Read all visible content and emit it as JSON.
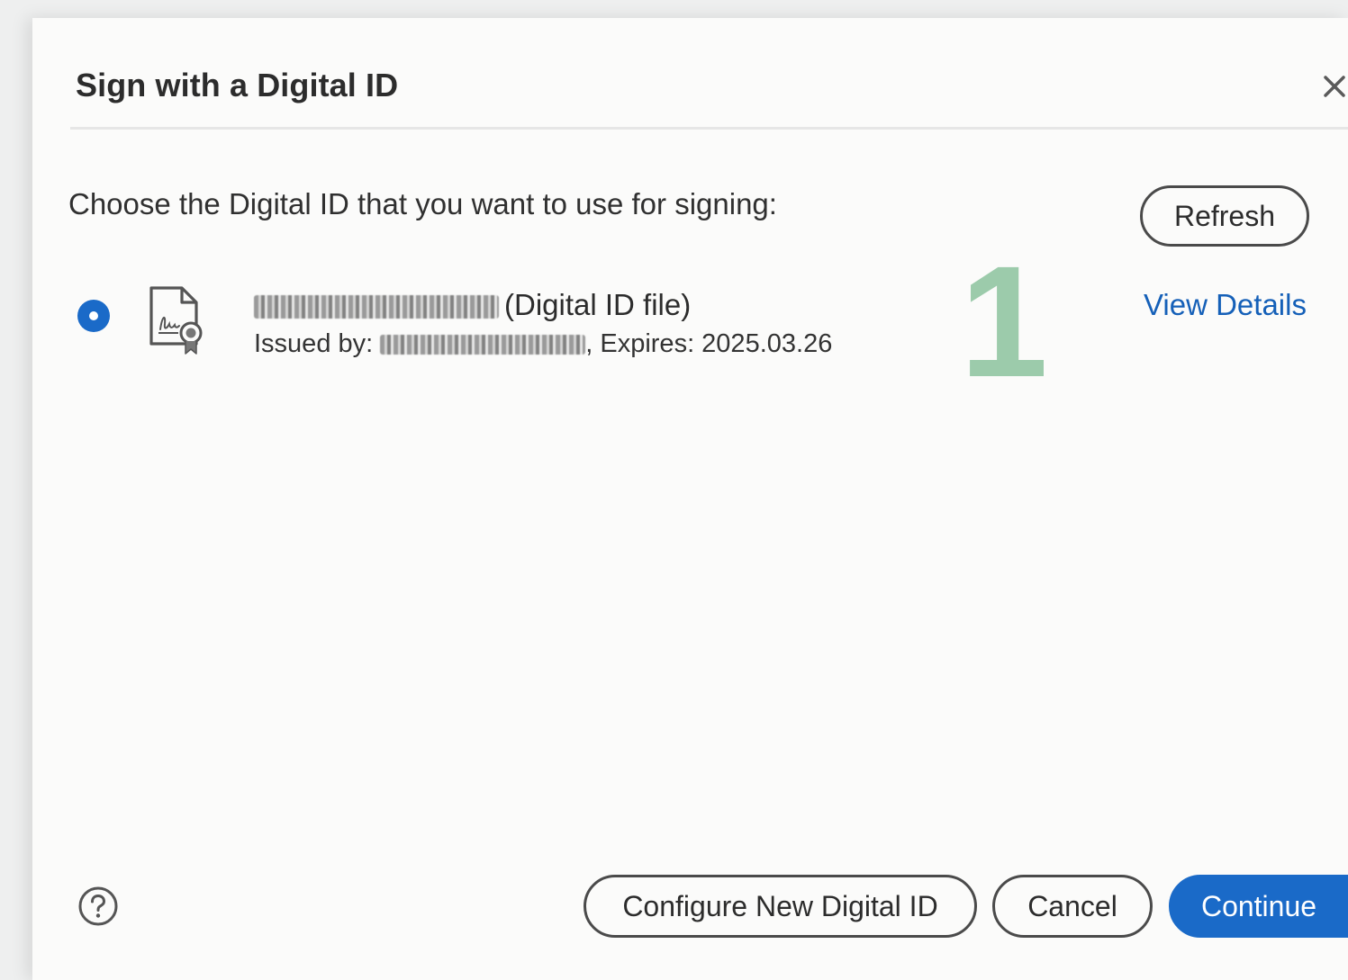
{
  "dialog": {
    "title": "Sign with a Digital ID",
    "close_icon": "close-icon",
    "prompt": "Choose the Digital ID that you want to use for signing:",
    "refresh_label": "Refresh",
    "view_details_label": "View Details"
  },
  "digital_id": {
    "selected": true,
    "icon": "certificate-icon",
    "name_redacted": true,
    "type_suffix": "(Digital ID file)",
    "issued_by_label": "Issued by:",
    "issuer_redacted": true,
    "expires_text": ", Expires: 2025.03.26"
  },
  "annotation": {
    "marker": "1"
  },
  "footer": {
    "help_icon": "help-icon",
    "configure_label": "Configure New Digital ID",
    "cancel_label": "Cancel",
    "continue_label": "Continue"
  },
  "colors": {
    "accent": "#1a6ac8",
    "link": "#1560b8",
    "marker": "#9ccbab"
  }
}
